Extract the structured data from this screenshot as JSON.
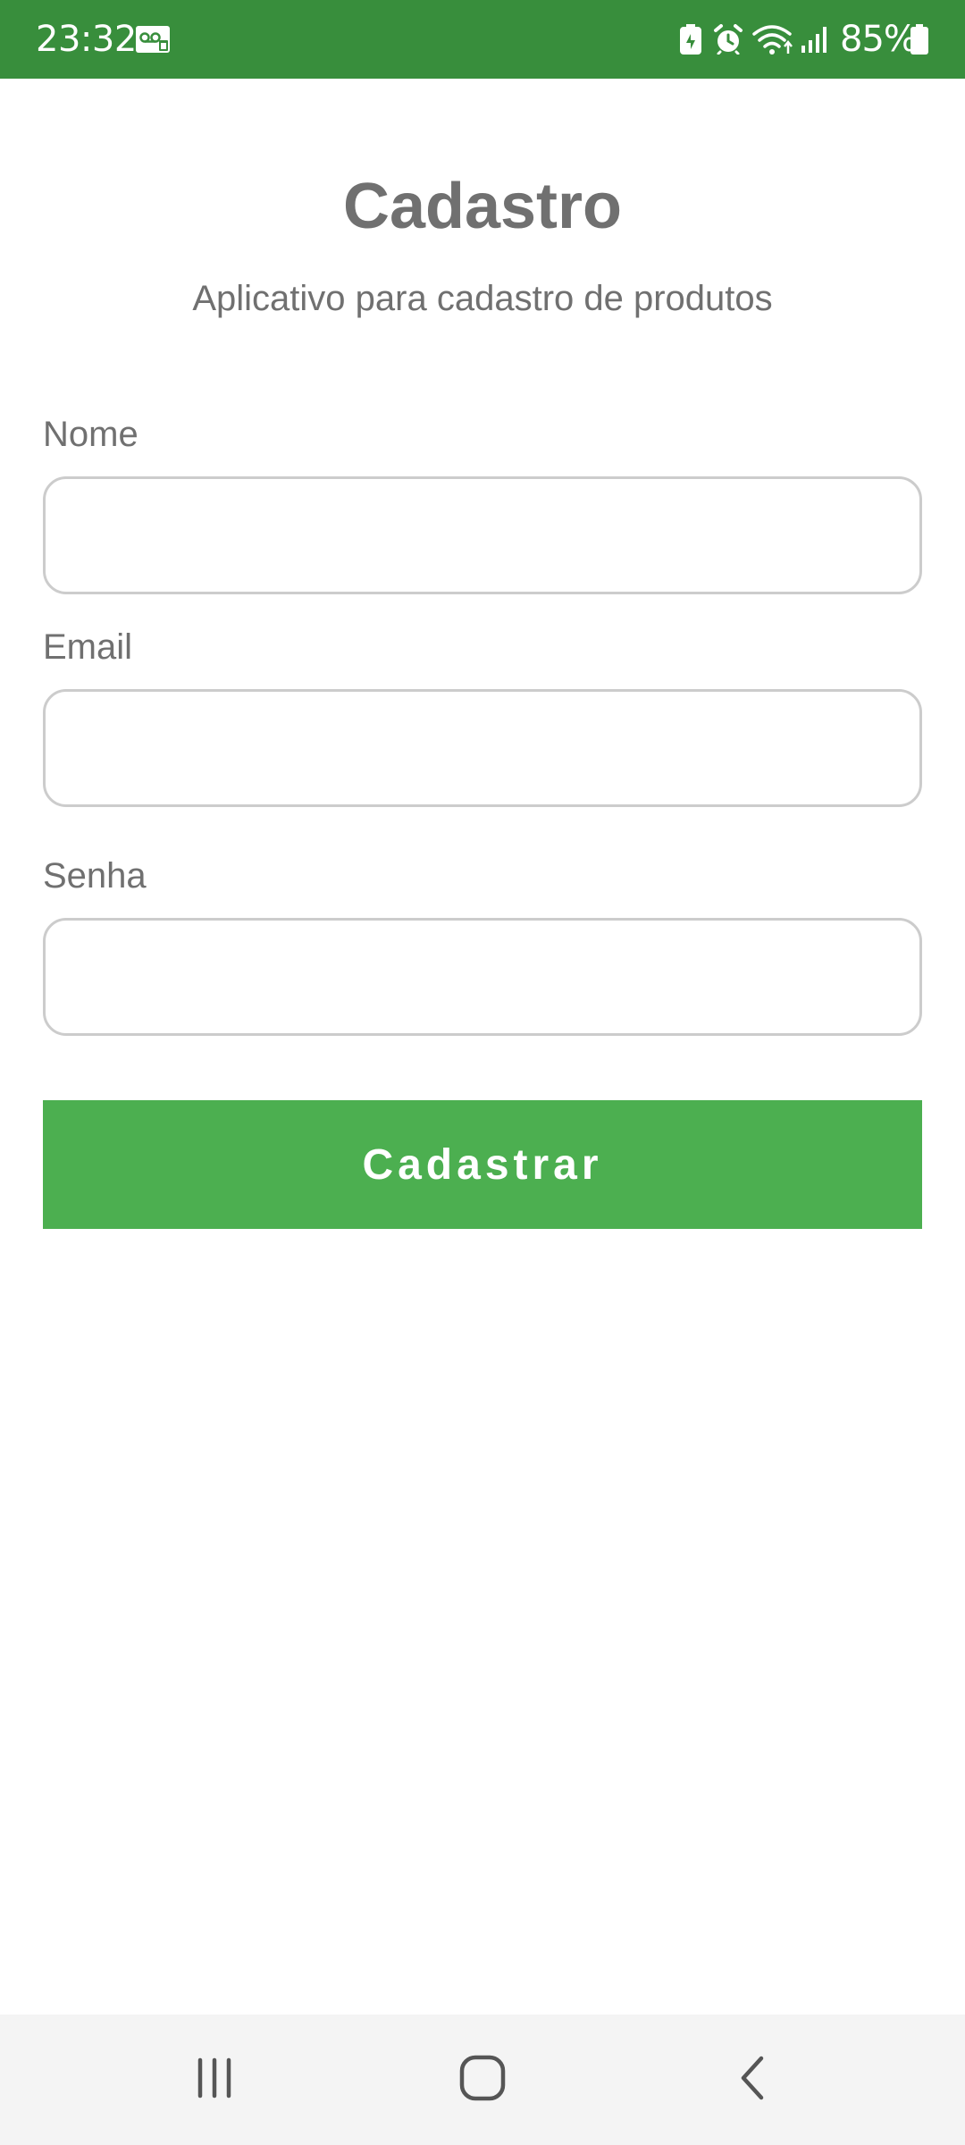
{
  "status_bar": {
    "time": "23:32",
    "battery": "85%",
    "background_color": "#388e3c",
    "icons": [
      "voicemail-icon",
      "battery-saver-icon",
      "alarm-icon",
      "wifi-icon",
      "signal-icon",
      "battery-icon"
    ]
  },
  "header": {
    "title": "Cadastro",
    "subtitle": "Aplicativo para cadastro de produtos"
  },
  "form": {
    "fields": [
      {
        "label": "Nome",
        "value": "",
        "placeholder": ""
      },
      {
        "label": "Email",
        "value": "",
        "placeholder": ""
      },
      {
        "label": "Senha",
        "value": "",
        "placeholder": ""
      }
    ],
    "submit_label": "Cadastrar",
    "accent_color": "#4caf50"
  },
  "nav_bar": {
    "icons": [
      "recents-icon",
      "home-icon",
      "back-icon"
    ]
  }
}
